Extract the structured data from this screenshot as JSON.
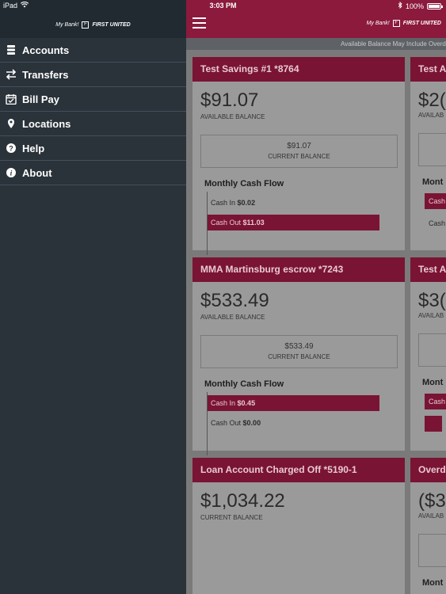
{
  "status_bar": {
    "device": "iPad",
    "time": "3:03 PM",
    "battery": "100%"
  },
  "logo": {
    "tagline": "My Bank!",
    "brand": "FIRST UNITED"
  },
  "menu": [
    {
      "label": "Accounts",
      "icon": "accounts-icon"
    },
    {
      "label": "Transfers",
      "icon": "transfer-arrows-icon"
    },
    {
      "label": "Bill Pay",
      "icon": "calendar-check-icon"
    },
    {
      "label": "Locations",
      "icon": "map-pin-icon"
    },
    {
      "label": "Help",
      "icon": "question-circle-icon"
    },
    {
      "label": "About",
      "icon": "info-circle-icon"
    }
  ],
  "notice": "Available Balance May Include Overd",
  "cards": [
    {
      "title": "Test Savings #1 *8764",
      "amount": "$91.07",
      "amount_label": "AVAILABLE BALANCE",
      "box_value": "$91.07",
      "box_label": "CURRENT BALANCE",
      "flow_title": "Monthly Cash Flow",
      "cash_in_label": "Cash In",
      "cash_in_value": "$0.02",
      "cash_out_label": "Cash Out",
      "cash_out_value": "$11.03",
      "cash_in_fraction": 0.0,
      "cash_out_fraction": 1.0
    },
    {
      "title": "MMA Martinsburg escrow *7243",
      "amount": "$533.49",
      "amount_label": "AVAILABLE BALANCE",
      "box_value": "$533.49",
      "box_label": "CURRENT BALANCE",
      "flow_title": "Monthly Cash Flow",
      "cash_in_label": "Cash In",
      "cash_in_value": "$0.45",
      "cash_out_label": "Cash Out",
      "cash_out_value": "$0.00",
      "cash_in_fraction": 1.0,
      "cash_out_fraction": 0.0
    },
    {
      "title": "Loan Account Charged Off *5190-1",
      "amount": "$1,034.22",
      "amount_label": "CURRENT BALANCE"
    }
  ],
  "stubs": [
    {
      "title": "Test A",
      "amount": "$2(",
      "amount_label": "AVAILAB",
      "flow_title": "Mont",
      "bar1": "Cash",
      "bar2": "Cash"
    },
    {
      "title": "Test A",
      "amount": "$3(",
      "amount_label": "AVAILAB",
      "flow_title": "Mont",
      "bar1": "Cash",
      "bar2": ""
    },
    {
      "title": "Overd",
      "amount": "($3",
      "amount_label": "AVAILAB",
      "flow_title": "Mont"
    }
  ]
}
